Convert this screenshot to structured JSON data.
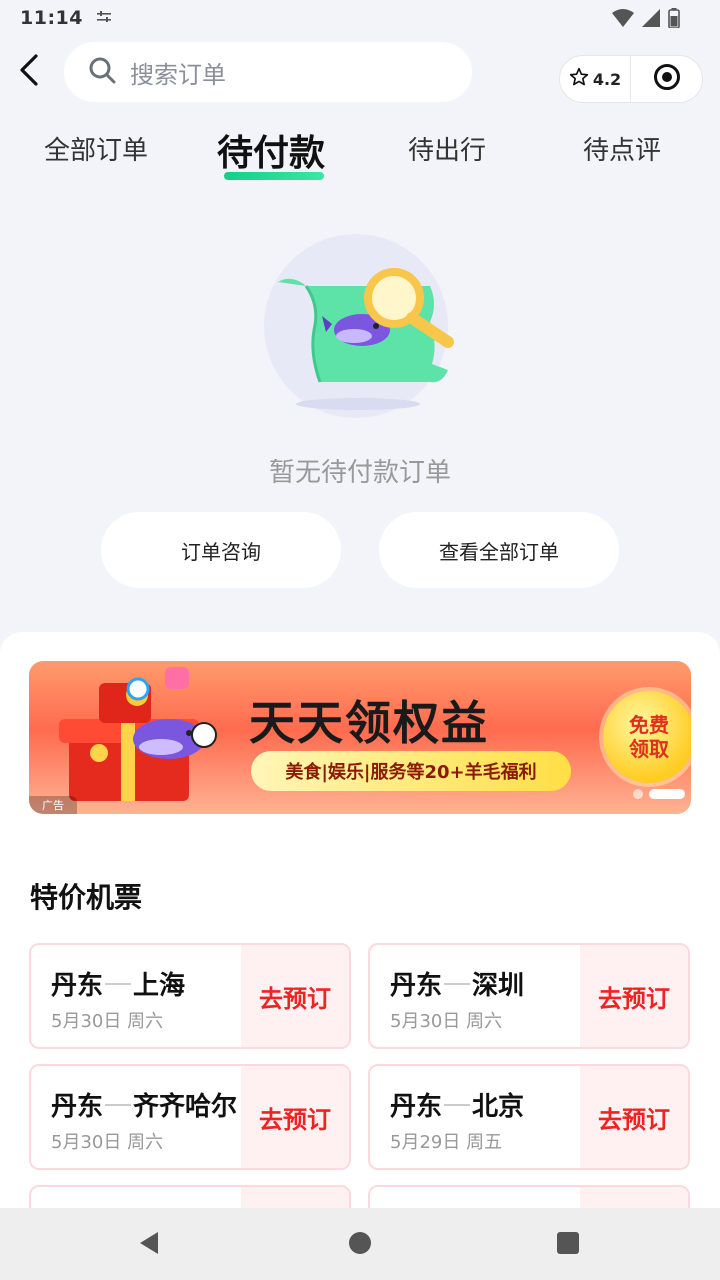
{
  "status_bar": {
    "time": "11:14",
    "notif_icon": "settings-sliders-icon"
  },
  "header": {
    "back_icon": "chevron-left-icon",
    "search_placeholder": "搜索订单",
    "rating": "4.2"
  },
  "tabs": [
    {
      "label": "全部订单",
      "active": false
    },
    {
      "label": "待付款",
      "active": true
    },
    {
      "label": "待出行",
      "active": false
    },
    {
      "label": "待点评",
      "active": false
    }
  ],
  "empty_state": {
    "message": "暂无待付款订单",
    "buttons": [
      "订单咨询",
      "查看全部订单"
    ]
  },
  "banner": {
    "title": "天天领权益",
    "subtitle": "美食|娱乐|服务等20+羊毛福利",
    "cta": [
      "免费",
      "领取"
    ],
    "ad_label": "广告",
    "slides": 3,
    "active_slide": 2
  },
  "flights": {
    "section_title": "特价机票",
    "book_label": "去预订",
    "items": [
      {
        "from": "丹东",
        "to": "上海",
        "date": "5月30日 周六"
      },
      {
        "from": "丹东",
        "to": "深圳",
        "date": "5月30日 周六"
      },
      {
        "from": "丹东",
        "to": "齐齐哈尔",
        "date": "5月30日 周六"
      },
      {
        "from": "丹东",
        "to": "北京",
        "date": "5月29日 周五"
      }
    ]
  },
  "colors": {
    "accent_green": "#15cf86",
    "price_red": "#ee2323",
    "page_bg": "#f2f4f9"
  }
}
